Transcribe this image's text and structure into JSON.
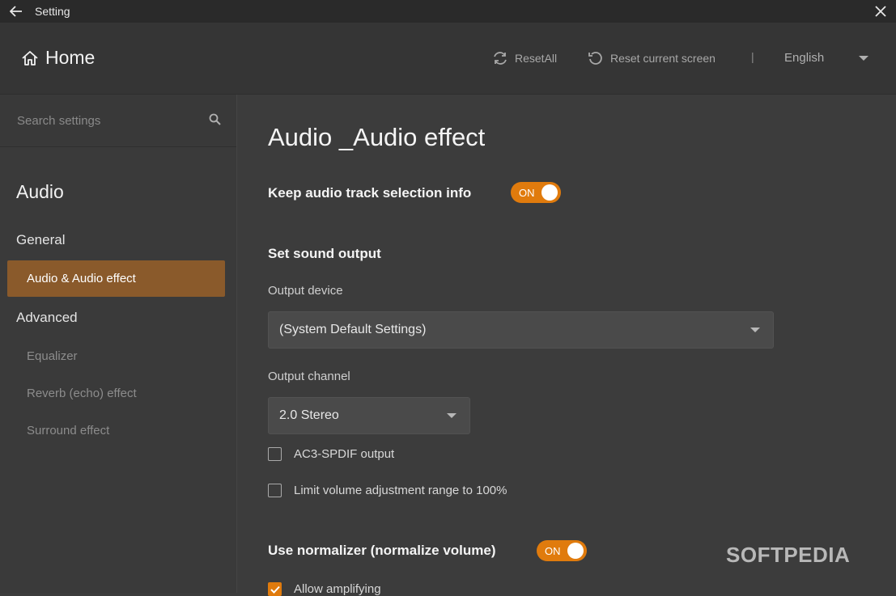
{
  "window": {
    "title": "Setting"
  },
  "header": {
    "home_label": "Home",
    "reset_all": "ResetAll",
    "reset_screen": "Reset current screen",
    "separator": "|",
    "language": "English"
  },
  "sidebar": {
    "search_placeholder": "Search settings",
    "section": "Audio",
    "items": [
      {
        "label": "General"
      },
      {
        "label": "Audio & Audio effect",
        "active": true
      },
      {
        "label": "Advanced"
      },
      {
        "label": "Equalizer"
      },
      {
        "label": "Reverb (echo) effect"
      },
      {
        "label": "Surround effect"
      }
    ]
  },
  "main": {
    "title": "Audio _Audio effect",
    "keep_track": {
      "label": "Keep audio track selection info",
      "toggle": "ON"
    },
    "sound_output_heading": "Set sound output",
    "output_device": {
      "label": "Output device",
      "value": "(System Default Settings)"
    },
    "output_channel": {
      "label": "Output channel",
      "value": "2.0 Stereo"
    },
    "checkboxes": [
      {
        "label": "AC3-SPDIF output",
        "checked": false
      },
      {
        "label": "Limit volume adjustment range to 100%",
        "checked": false
      },
      {
        "label": "Allow amplifying",
        "checked": true
      }
    ],
    "normalizer": {
      "label": "Use normalizer (normalize volume)",
      "toggle": "ON"
    }
  },
  "watermark": "SOFTPEDIA",
  "colors": {
    "accent": "#e07b0d",
    "active_item": "#8a5a2b",
    "background": "#3c3c3c"
  }
}
